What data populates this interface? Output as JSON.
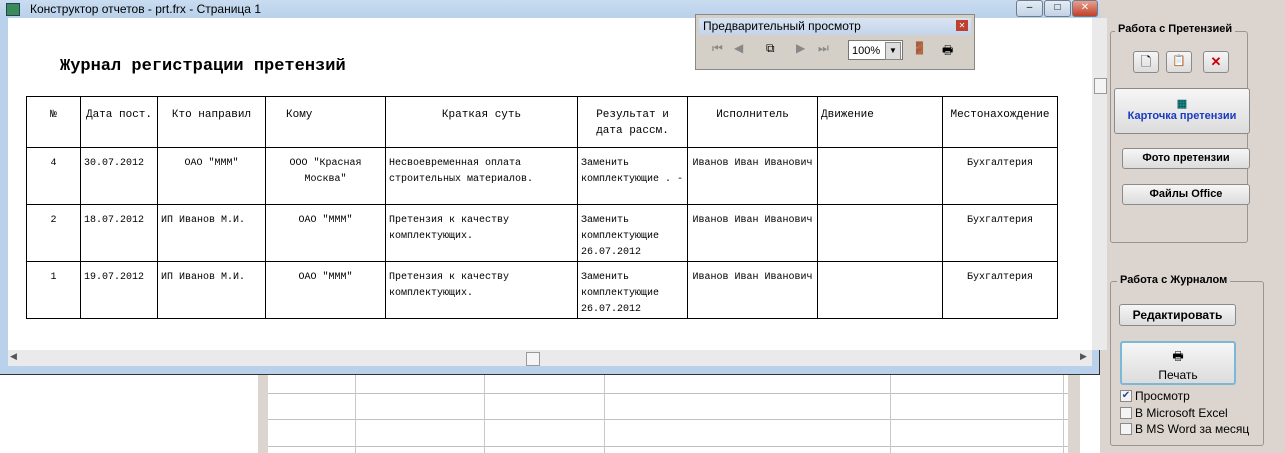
{
  "window": {
    "title": "Конструктор отчетов - prt.frx - Страница 1",
    "minimize": "‒",
    "maximize": "□",
    "close": "✕"
  },
  "report": {
    "title": "Журнал регистрации претензий",
    "columns": [
      "№",
      "Дата пост.",
      "Кто направил",
      "Кому",
      "Краткая суть",
      "Результат и дата рассм.",
      "Исполнитель",
      "Движение",
      "Местонахождение"
    ],
    "rows": [
      [
        "4",
        "30.07.2012",
        "ОАО \"МММ\"",
        "ООО \"Красная Москва\"",
        "Несвоевременная оплата строительных материалов.",
        "Заменить комплектующие . -",
        "Иванов Иван Иванович",
        "",
        "Бухгалтерия"
      ],
      [
        "2",
        "18.07.2012",
        "ИП Иванов М.И.",
        "ОАО \"МММ\"",
        "Претензия к качеству комплектующих.",
        "Заменить комплектующие 26.07.2012",
        "Иванов Иван Иванович",
        "",
        "Бухгалтерия"
      ],
      [
        "1",
        "19.07.2012",
        "ИП Иванов М.И.",
        "ОАО \"МММ\"",
        "Претензия к качеству комплектующих.",
        "Заменить комплектующие 26.07.2012",
        "Иванов Иван Иванович",
        "",
        "Бухгалтерия"
      ]
    ]
  },
  "preview_toolbar": {
    "title": "Предварительный просмотр",
    "zoom": "100%"
  },
  "panel": {
    "claim_group": "Работа с Претензией",
    "card_button": "Карточка претензии",
    "photo_button": "Фото претензии",
    "office_button": "Файлы Office",
    "journal_group": "Работа с Журналом",
    "edit_button": "Редактировать",
    "print_button": "Печать",
    "options": [
      {
        "label": "Просмотр",
        "checked": true
      },
      {
        "label": "В Microsoft Excel",
        "checked": false
      },
      {
        "label": "В MS Word за месяц",
        "checked": false
      }
    ]
  }
}
